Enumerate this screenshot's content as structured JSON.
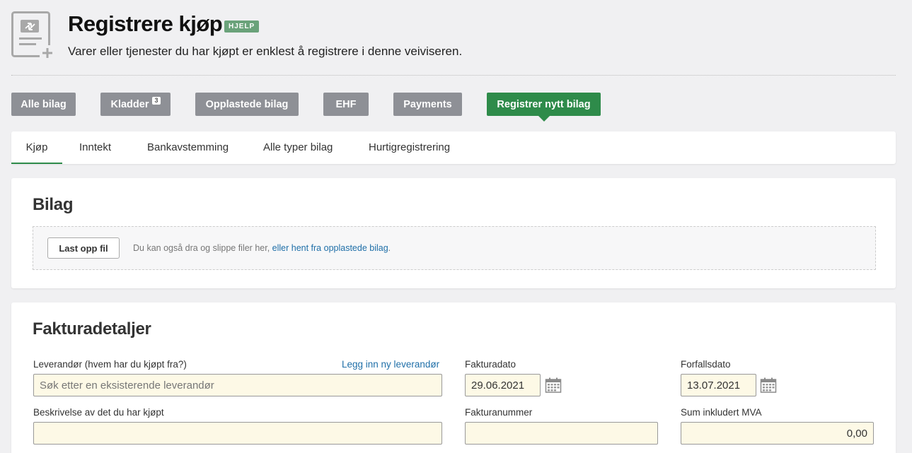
{
  "header": {
    "title": "Registrere kjøp",
    "help_label": "HJELP",
    "subtitle": "Varer eller tjenester du har kjøpt er enklest å registrere i denne veiviseren."
  },
  "pill_tabs": [
    {
      "label": "Alle bilag"
    },
    {
      "label": "Kladder",
      "count": "3"
    },
    {
      "label": "Opplastede bilag"
    },
    {
      "label": "EHF"
    },
    {
      "label": "Payments"
    },
    {
      "label": "Registrer nytt bilag",
      "active": true
    }
  ],
  "subnav": [
    {
      "label": "Kjøp",
      "active": true
    },
    {
      "label": "Inntekt"
    },
    {
      "label": "Bankavstemming"
    },
    {
      "label": "Alle typer bilag"
    },
    {
      "label": "Hurtigregistrering"
    }
  ],
  "bilag": {
    "title": "Bilag",
    "upload_label": "Last opp fil",
    "drop_text": "Du kan også dra og slippe filer her, ",
    "drop_link": "eller hent fra opplastede bilag",
    "drop_end": "."
  },
  "faktura": {
    "title": "Fakturadetaljer",
    "supplier_label": "Leverandør (hvem har du kjøpt fra?)",
    "supplier_link": "Legg inn ny leverandør",
    "supplier_placeholder": "Søk etter en eksisterende leverandør",
    "description_label": "Beskrivelse av det du har kjøpt",
    "description_value": "",
    "invoice_date_label": "Fakturadato",
    "invoice_date_value": "29.06.2021",
    "due_date_label": "Forfallsdato",
    "due_date_value": "13.07.2021",
    "invoice_number_label": "Fakturanummer",
    "invoice_number_value": "",
    "sum_label": "Sum inkludert MVA",
    "sum_value": "0,00"
  },
  "colors": {
    "accent_green": "#2e8b4a",
    "pill_gray": "#8e9096",
    "link_blue": "#1f6fa8",
    "input_bg": "#fdf9e6",
    "help_badge": "#6aa27a"
  },
  "icons": {
    "page": "document-add-icon",
    "calendar": "calendar-icon"
  }
}
